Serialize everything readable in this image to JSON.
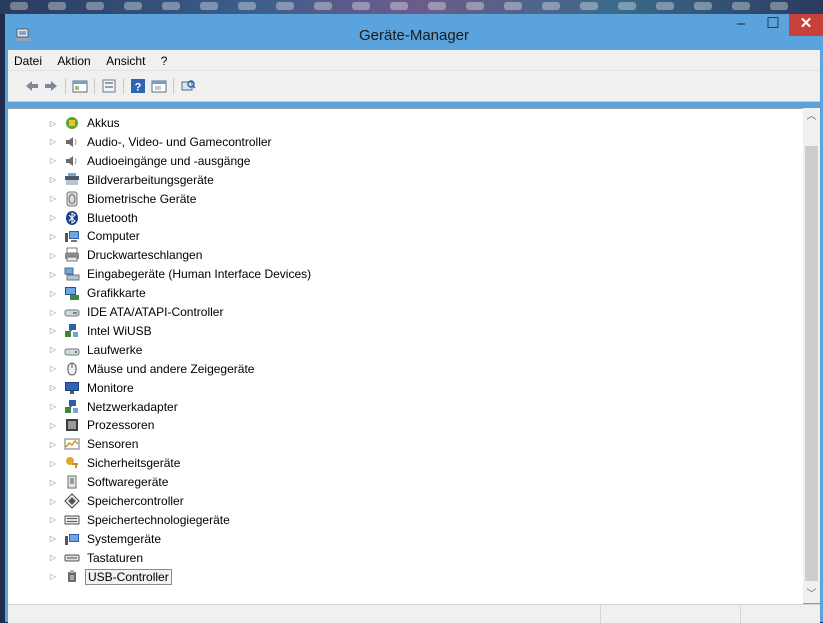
{
  "window": {
    "title": "Geräte-Manager",
    "close_glyph": "✕",
    "min_glyph": "–",
    "max_glyph": "☐"
  },
  "menu": [
    "Datei",
    "Aktion",
    "Ansicht",
    "?"
  ],
  "toolbar_icons": [
    "back-icon",
    "forward-icon",
    "properties-icon",
    "update-driver-icon",
    "help-icon",
    "show-hidden-icon",
    "scan-hardware-icon"
  ],
  "devices": [
    {
      "label": "Akkus",
      "icon": "battery-icon"
    },
    {
      "label": "Audio-, Video- und Gamecontroller",
      "icon": "speaker-icon"
    },
    {
      "label": "Audioeingänge und -ausgänge",
      "icon": "speaker-icon"
    },
    {
      "label": "Bildverarbeitungsgeräte",
      "icon": "scanner-icon"
    },
    {
      "label": "Biometrische Geräte",
      "icon": "fingerprint-icon"
    },
    {
      "label": "Bluetooth",
      "icon": "bluetooth-icon"
    },
    {
      "label": "Computer",
      "icon": "computer-icon"
    },
    {
      "label": "Druckwarteschlangen",
      "icon": "printer-icon"
    },
    {
      "label": "Eingabegeräte (Human Interface Devices)",
      "icon": "hid-icon"
    },
    {
      "label": "Grafikkarte",
      "icon": "display-adapter-icon"
    },
    {
      "label": "IDE ATA/ATAPI-Controller",
      "icon": "ide-controller-icon"
    },
    {
      "label": "Intel WiUSB",
      "icon": "network-icon"
    },
    {
      "label": "Laufwerke",
      "icon": "disk-drive-icon"
    },
    {
      "label": "Mäuse und andere Zeigegeräte",
      "icon": "mouse-icon"
    },
    {
      "label": "Monitore",
      "icon": "monitor-icon"
    },
    {
      "label": "Netzwerkadapter",
      "icon": "network-icon"
    },
    {
      "label": "Prozessoren",
      "icon": "processor-icon"
    },
    {
      "label": "Sensoren",
      "icon": "sensor-icon"
    },
    {
      "label": "Sicherheitsgeräte",
      "icon": "security-key-icon"
    },
    {
      "label": "Softwaregeräte",
      "icon": "software-device-icon"
    },
    {
      "label": "Speichercontroller",
      "icon": "storage-controller-icon"
    },
    {
      "label": "Speichertechnologiegeräte",
      "icon": "memory-technology-icon"
    },
    {
      "label": "Systemgeräte",
      "icon": "system-device-icon"
    },
    {
      "label": "Tastaturen",
      "icon": "keyboard-icon"
    },
    {
      "label": "USB-Controller",
      "icon": "usb-icon",
      "selected": true
    }
  ],
  "colors": {
    "title_bar": "#5ba3dc",
    "close_button": "#c7403a",
    "chrome": "#f0f0f0"
  }
}
